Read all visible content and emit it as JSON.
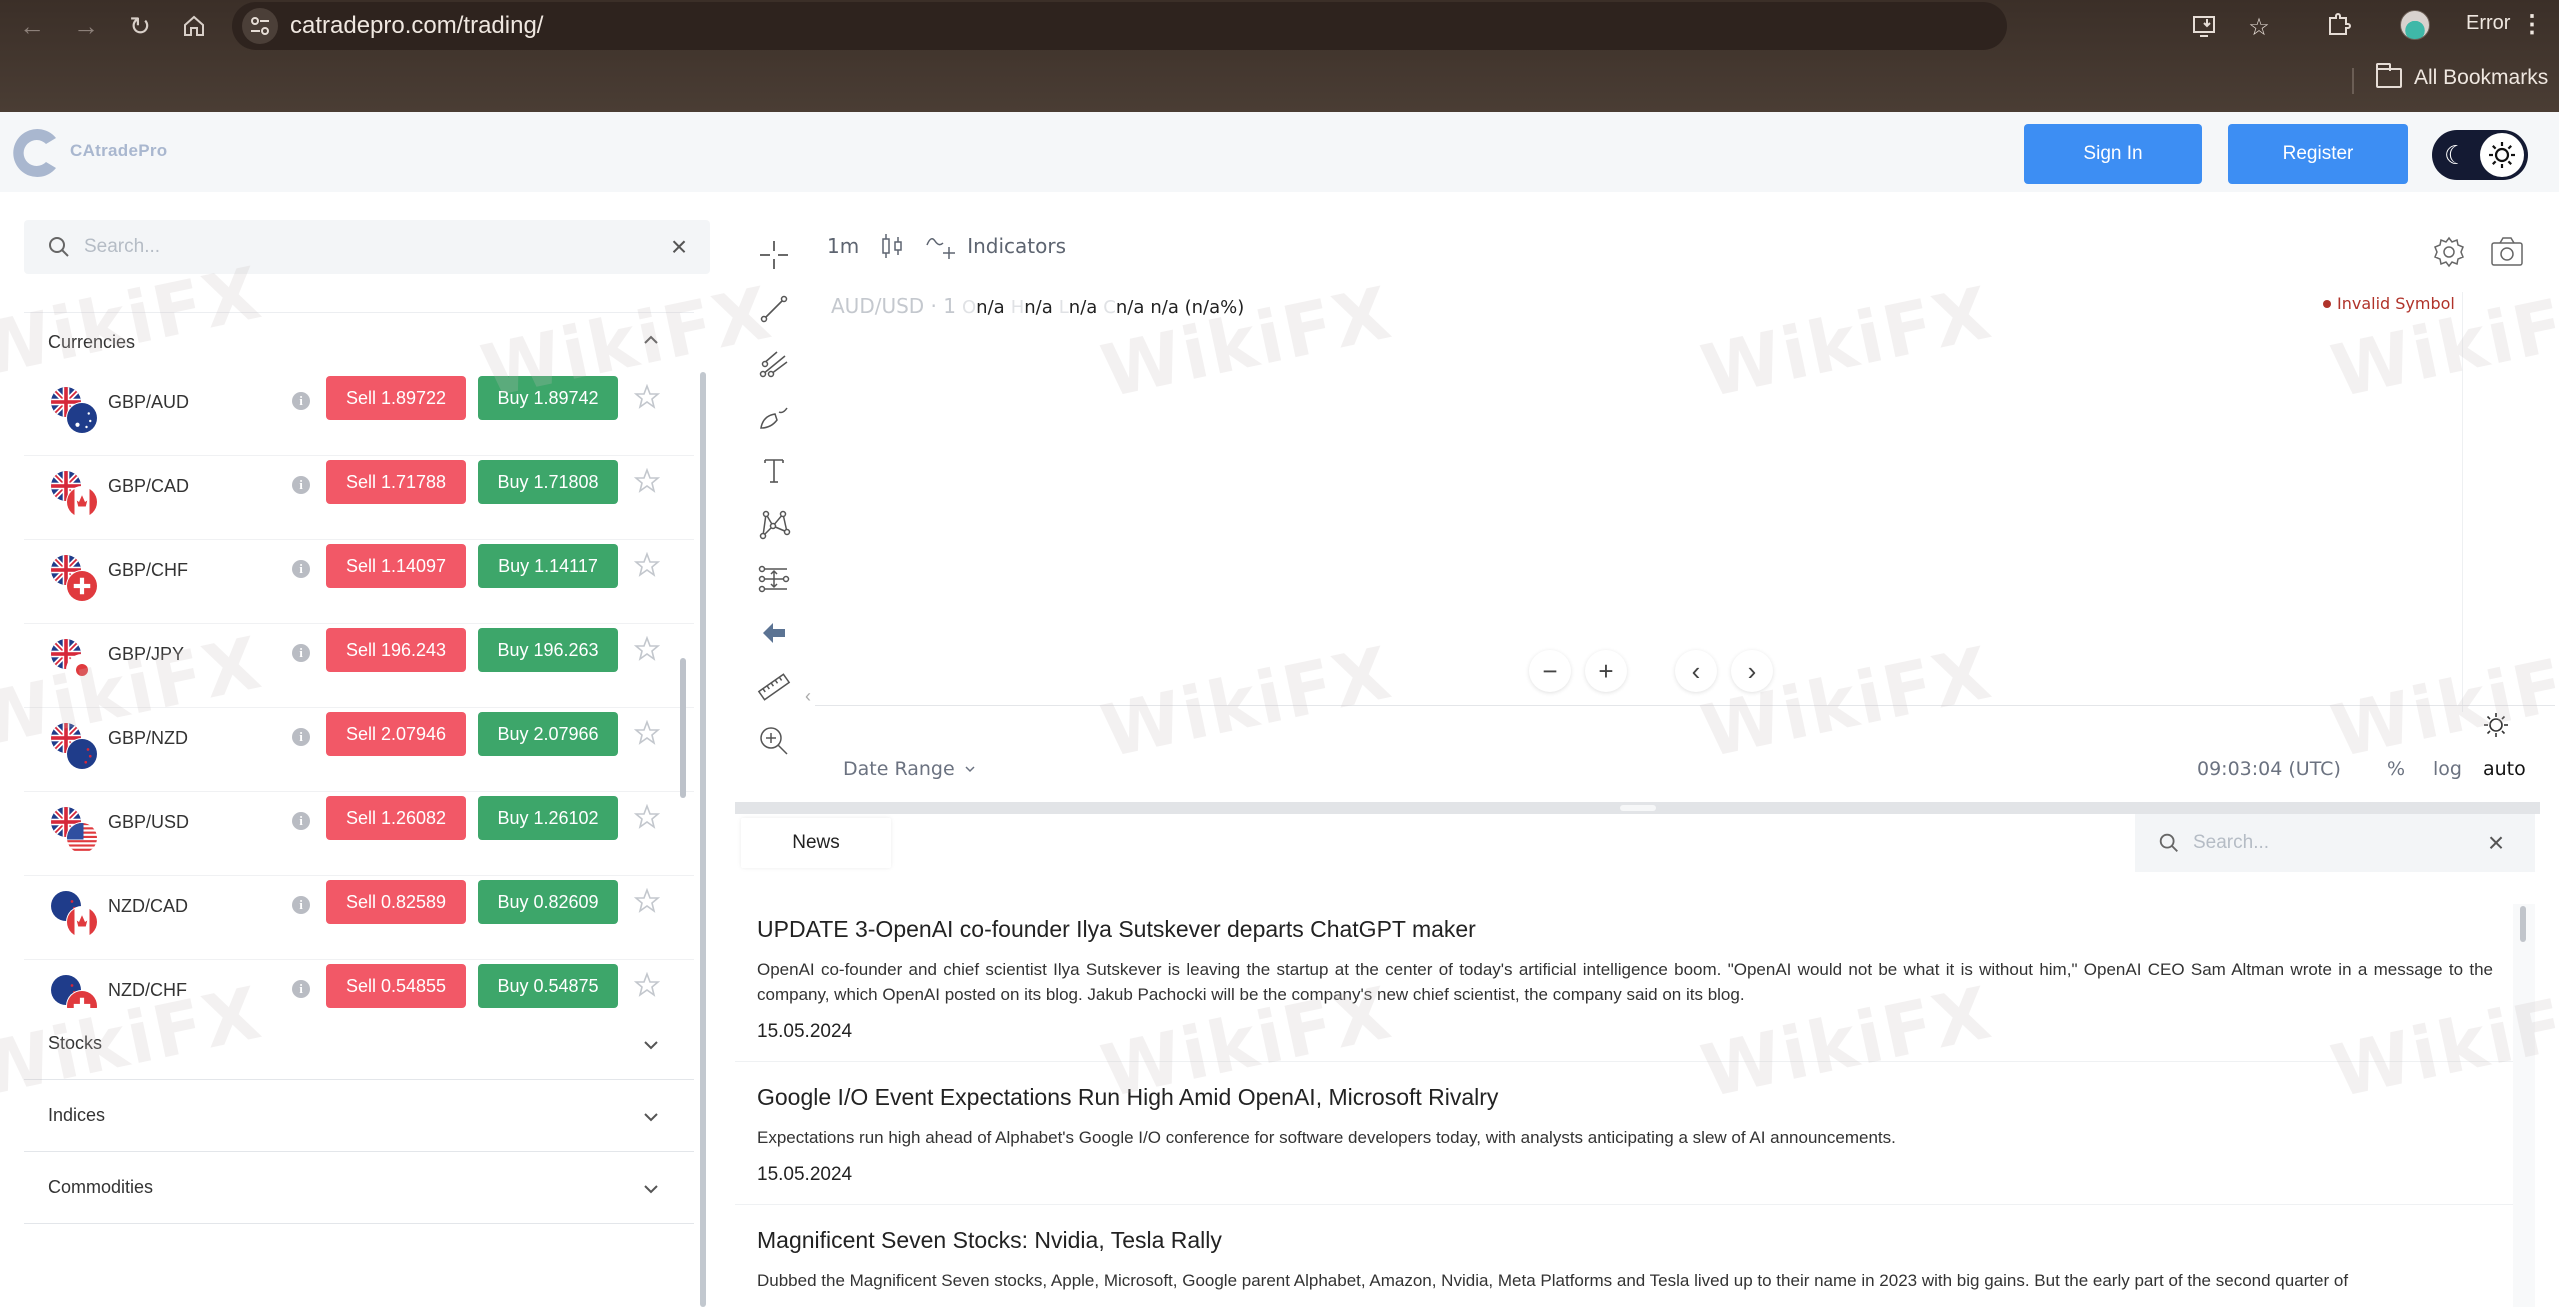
{
  "browser": {
    "url": "catradepro.com/trading/",
    "profile_status": "Error",
    "bookmarks_label": "All Bookmarks",
    "icons": [
      "back-icon",
      "forward-icon",
      "reload-icon",
      "home-icon",
      "site-info-icon",
      "install-app-icon",
      "bookmark-star-icon",
      "extensions-icon",
      "profile-avatar",
      "menu-kebab-icon",
      "folder-icon"
    ]
  },
  "header": {
    "brand": "CAtradePro",
    "sign_in": "Sign In",
    "register": "Register",
    "theme_toggle": {
      "moon": "☾",
      "mode": "light"
    }
  },
  "sidebar": {
    "search_placeholder": "Search...",
    "categories": {
      "currencies": "Currencies",
      "stocks": "Stocks",
      "indices": "Indices",
      "commodities": "Commodities"
    },
    "instruments": [
      {
        "symbol": "GBP/AUD",
        "base": "GB",
        "quote": "AU",
        "sell": "Sell 1.89722",
        "buy": "Buy 1.89742"
      },
      {
        "symbol": "GBP/CAD",
        "base": "GB",
        "quote": "CA",
        "sell": "Sell 1.71788",
        "buy": "Buy 1.71808"
      },
      {
        "symbol": "GBP/CHF",
        "base": "GB",
        "quote": "CH",
        "sell": "Sell 1.14097",
        "buy": "Buy 1.14117"
      },
      {
        "symbol": "GBP/JPY",
        "base": "GB",
        "quote": "JP",
        "sell": "Sell 196.243",
        "buy": "Buy 196.263"
      },
      {
        "symbol": "GBP/NZD",
        "base": "GB",
        "quote": "NZ",
        "sell": "Sell 2.07946",
        "buy": "Buy 2.07966"
      },
      {
        "symbol": "GBP/USD",
        "base": "GB",
        "quote": "US",
        "sell": "Sell 1.26082",
        "buy": "Buy 1.26102"
      },
      {
        "symbol": "NZD/CAD",
        "base": "NZ",
        "quote": "CA",
        "sell": "Sell 0.82589",
        "buy": "Buy 0.82609"
      },
      {
        "symbol": "NZD/CHF",
        "base": "NZ",
        "quote": "CH",
        "sell": "Sell 0.54855",
        "buy": "Buy 0.54875"
      }
    ],
    "info_glyph": "i"
  },
  "chart": {
    "interval": "1m",
    "indicators_label": "Indicators",
    "symbol_label": "AUD/USD · 1",
    "ohlc": [
      {
        "key": "O",
        "value": "n/a"
      },
      {
        "key": "H",
        "value": "n/a"
      },
      {
        "key": "L",
        "value": "n/a"
      },
      {
        "key": "C",
        "value": "n/a"
      }
    ],
    "change": "n/a (n/a%)",
    "status": "Invalid Symbol",
    "date_range_label": "Date Range",
    "clock": "09:03:04 (UTC)",
    "scale_percent": "%",
    "scale_log": "log",
    "scale_auto": "auto",
    "tools": [
      "crosshair-icon",
      "trend-line-icon",
      "pitchfork-icon",
      "brush-icon",
      "text-icon",
      "pattern-icon",
      "measure-projection-icon",
      "back-arrow-icon",
      "ruler-icon",
      "zoom-in-icon"
    ],
    "nav_controls": {
      "zoom_out": "−",
      "zoom_in": "+",
      "scroll_left": "‹",
      "scroll_right": "›"
    },
    "colors": {
      "status": "#b0332a"
    }
  },
  "news": {
    "tab_label": "News",
    "search_placeholder": "Search...",
    "items": [
      {
        "title": "UPDATE 3-OpenAI co-founder Ilya Sutskever departs ChatGPT maker",
        "body": "OpenAI co-founder and chief scientist Ilya Sutskever is leaving the startup at the center of today's artificial intelligence boom. \"OpenAI would not be what it is without him,\" OpenAI CEO Sam Altman wrote in a message to the company, which OpenAI posted on its blog. Jakub Pachocki will be the company's new chief scientist, the company said on its blog.",
        "date": "15.05.2024"
      },
      {
        "title": "Google I/O Event Expectations Run High Amid OpenAI, Microsoft Rivalry",
        "body": "Expectations run high ahead of Alphabet's Google I/O conference for software developers today, with analysts anticipating a slew of AI announcements.",
        "date": "15.05.2024"
      },
      {
        "title": "Magnificent Seven Stocks: Nvidia, Tesla Rally",
        "body": "Dubbed the Magnificent Seven stocks, Apple, Microsoft, Google parent Alphabet, Amazon, Nvidia, Meta Platforms and Tesla lived up to their name in 2023 with big gains. But the early part of the second quarter of",
        "date": ""
      }
    ]
  },
  "colors": {
    "sell": "#f25867",
    "buy": "#3da66a",
    "primary": "#3d8ef3",
    "toggle_bg": "#141a33"
  },
  "watermark": "WikiFX"
}
